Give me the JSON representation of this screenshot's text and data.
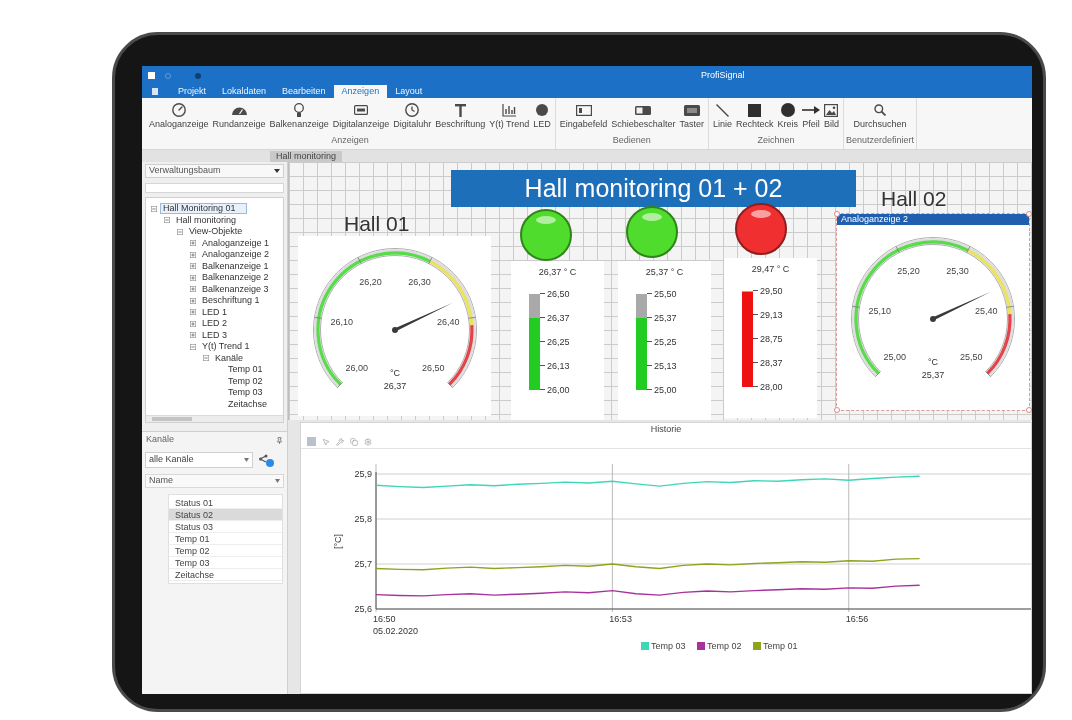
{
  "window": {
    "title": "ProfiSignal"
  },
  "ribbon_tabs": [
    {
      "label": "Projekt",
      "selected": false
    },
    {
      "label": "Lokaldaten",
      "selected": false
    },
    {
      "label": "Bearbeiten",
      "selected": false
    },
    {
      "label": "Anzeigen",
      "selected": true
    },
    {
      "label": "Layout",
      "selected": false
    }
  ],
  "ribbon_groups": [
    {
      "label": "Anzeigen",
      "tools": [
        {
          "label": "Analoganzeige",
          "kind": "gauge"
        },
        {
          "label": "Rundanzeige",
          "kind": "speedometer"
        },
        {
          "label": "Balkenanzeige",
          "kind": "bulb"
        },
        {
          "label": "Digitalanzeige",
          "kind": "display"
        },
        {
          "label": "Digitaluhr",
          "kind": "clock"
        },
        {
          "label": "Beschriftung",
          "kind": "text"
        },
        {
          "label": "Y(t) Trend",
          "kind": "trend"
        },
        {
          "label": "LED",
          "kind": "led"
        }
      ]
    },
    {
      "label": "Bedienen",
      "tools": [
        {
          "label": "Eingabefeld",
          "kind": "input"
        },
        {
          "label": "Schiebeschalter",
          "kind": "toggle"
        },
        {
          "label": "Taster",
          "kind": "pushbutton"
        }
      ]
    },
    {
      "label": "Zeichnen",
      "tools": [
        {
          "label": "Linie",
          "kind": "line"
        },
        {
          "label": "Rechteck",
          "kind": "rect"
        },
        {
          "label": "Kreis",
          "kind": "circle"
        },
        {
          "label": "Pfeil",
          "kind": "arrow"
        },
        {
          "label": "Bild",
          "kind": "image"
        }
      ]
    },
    {
      "label": "Benutzerdefiniert",
      "tools": [
        {
          "label": "Durchsuchen",
          "kind": "search"
        }
      ]
    }
  ],
  "document_tab": "Hall monitoring",
  "tree_panel": {
    "title": "Verwaltungsbaum",
    "items": [
      {
        "label": "Hall Monitoring 01",
        "selected": true,
        "expanded": true,
        "children": [
          {
            "label": "Hall monitoring",
            "selected": false,
            "expanded": true,
            "children": [
              {
                "label": "View-Objekte",
                "selected": false,
                "expanded": true,
                "children": [
                  {
                    "label": "Analoganzeige 1",
                    "selected": false,
                    "expanded": false
                  },
                  {
                    "label": "Analoganzeige 2",
                    "selected": false,
                    "expanded": false
                  },
                  {
                    "label": "Balkenanzeige 1",
                    "selected": false,
                    "expanded": false
                  },
                  {
                    "label": "Balkenanzeige 2",
                    "selected": false,
                    "expanded": false
                  },
                  {
                    "label": "Balkenanzeige 3",
                    "selected": false,
                    "expanded": false
                  },
                  {
                    "label": "Beschriftung 1",
                    "selected": false,
                    "expanded": false
                  },
                  {
                    "label": "LED 1",
                    "selected": false,
                    "expanded": false
                  },
                  {
                    "label": "LED 2",
                    "selected": false,
                    "expanded": false
                  },
                  {
                    "label": "LED 3",
                    "selected": false,
                    "expanded": false
                  },
                  {
                    "label": "Y(t) Trend 1",
                    "selected": false,
                    "expanded": true,
                    "children": [
                      {
                        "label": "Kanäle",
                        "selected": false,
                        "expanded": true,
                        "children": [
                          {
                            "label": "Temp 01",
                            "selected": false
                          },
                          {
                            "label": "Temp 02",
                            "selected": false
                          },
                          {
                            "label": "Temp 03",
                            "selected": false
                          },
                          {
                            "label": "Zeitachse",
                            "selected": false
                          }
                        ]
                      }
                    ]
                  }
                ]
              }
            ]
          }
        ]
      }
    ]
  },
  "channels_panel": {
    "title": "Kanäle",
    "filter": "alle Kanäle",
    "column": "Name",
    "items": [
      {
        "label": "Status 01",
        "selected": false
      },
      {
        "label": "Status 02",
        "selected": true
      },
      {
        "label": "Status 03",
        "selected": false
      },
      {
        "label": "Temp 01",
        "selected": false
      },
      {
        "label": "Temp 02",
        "selected": false
      },
      {
        "label": "Temp 03",
        "selected": false
      },
      {
        "label": "Zeitachse",
        "selected": false
      }
    ]
  },
  "canvas": {
    "banner": "Hall monitoring 01 + 02",
    "gauges": [
      {
        "title": "Hall 01",
        "selected": false,
        "scale": [
          "26,00",
          "26,10",
          "26,20",
          "26,30",
          "26,40",
          "26,50"
        ],
        "unit": "°C",
        "reading": "26,37",
        "level": 0.74
      },
      {
        "title": "Hall 02",
        "selected": true,
        "caption": "Analoganzeige 2",
        "scale": [
          "25,00",
          "25,10",
          "25,20",
          "25,30",
          "25,40",
          "25,50"
        ],
        "unit": "°C",
        "reading": "25,37",
        "level": 0.74
      }
    ],
    "leds": [
      {
        "color": "#4fdc2c"
      },
      {
        "color": "#4fdc2c"
      },
      {
        "color": "#f03030"
      }
    ],
    "bars": [
      {
        "reading": "26,37 ° C",
        "scale": [
          "26,50",
          "26,37",
          "26,25",
          "26,13",
          "26,00"
        ],
        "level": 0.74,
        "color": "#22cc22"
      },
      {
        "reading": "25,37 ° C",
        "scale": [
          "25,50",
          "25,37",
          "25,25",
          "25,13",
          "25,00"
        ],
        "level": 0.74,
        "color": "#22cc22"
      },
      {
        "reading": "29,47 ° C",
        "scale": [
          "29,50",
          "29,13",
          "28,75",
          "28,37",
          "28,00"
        ],
        "level": 0.98,
        "color": "#ee1111"
      }
    ]
  },
  "chart_panel": {
    "title": "Historie",
    "date": "05.02.2020",
    "chart_data": {
      "type": "line",
      "ylabel": "[°C]",
      "categories": [
        "16:50",
        null,
        null,
        null,
        null,
        null,
        null,
        null,
        null,
        null,
        "16:53",
        null,
        null,
        null,
        null,
        null,
        null,
        null,
        null,
        null,
        "16:56",
        null,
        null,
        null
      ],
      "series": [
        {
          "name": "Temp 03",
          "color": "#3dd6b8",
          "values": [
            25.875,
            25.872,
            25.87,
            25.873,
            25.876,
            25.874,
            25.877,
            25.879,
            25.882,
            25.88,
            25.884,
            25.878,
            25.873,
            25.879,
            25.883,
            25.881,
            25.885,
            25.884,
            25.887,
            25.889,
            25.886,
            25.89,
            25.893,
            25.895
          ]
        },
        {
          "name": "Temp 02",
          "color": "#a8329c",
          "values": [
            25.632,
            25.63,
            25.629,
            25.632,
            25.634,
            25.631,
            25.633,
            25.635,
            25.638,
            25.636,
            25.641,
            25.634,
            25.631,
            25.637,
            25.64,
            25.638,
            25.641,
            25.643,
            25.645,
            25.644,
            25.647,
            25.646,
            25.651,
            25.653
          ]
        },
        {
          "name": "Temp 01",
          "color": "#8fa31e",
          "values": [
            25.69,
            25.688,
            25.687,
            25.691,
            25.693,
            25.69,
            25.692,
            25.694,
            25.697,
            25.695,
            25.7,
            25.694,
            25.69,
            25.697,
            25.7,
            25.698,
            25.701,
            25.703,
            25.705,
            25.704,
            25.707,
            25.706,
            25.711,
            25.712
          ]
        }
      ],
      "ylim": [
        25.6,
        25.9
      ],
      "yticks": [
        {
          "value": 25.6,
          "label": "25,6"
        },
        {
          "value": 25.7,
          "label": "25,7"
        },
        {
          "value": 25.8,
          "label": "25,8"
        },
        {
          "value": 25.9,
          "label": "25,9"
        }
      ],
      "legend": "bottom"
    }
  }
}
